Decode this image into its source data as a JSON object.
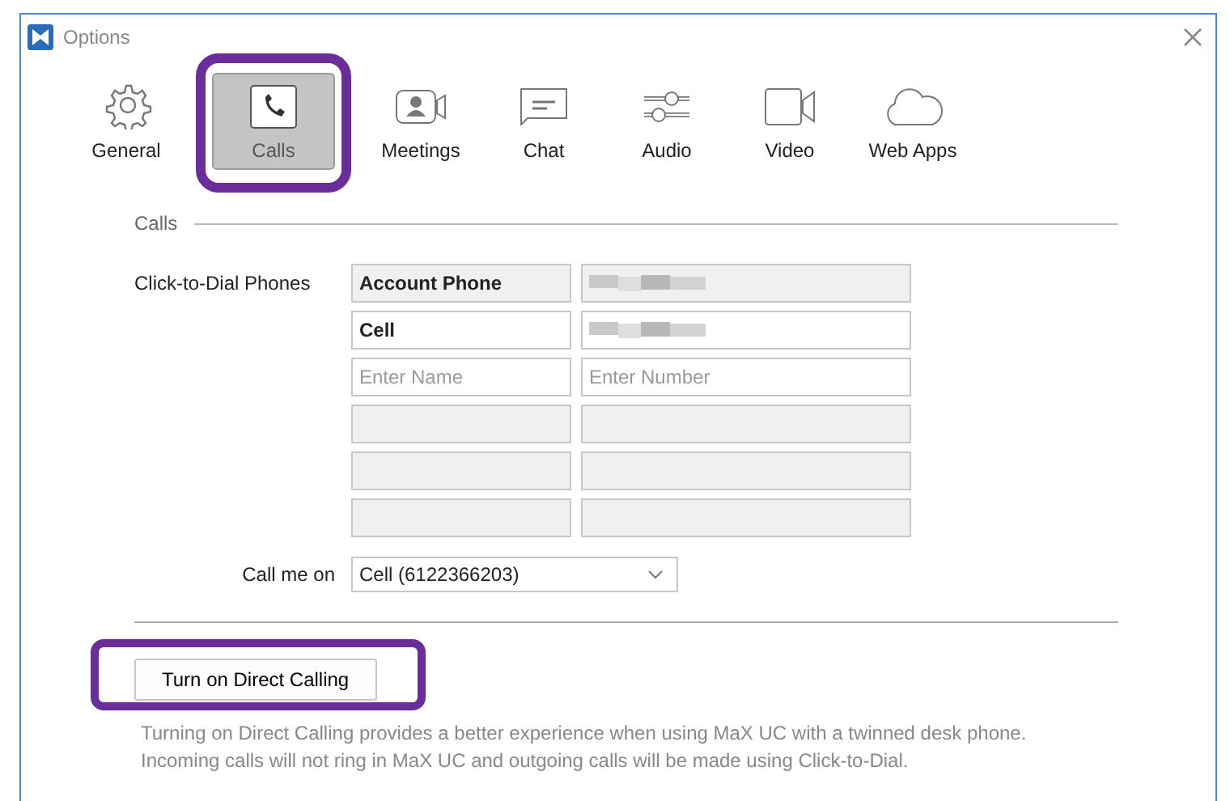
{
  "window": {
    "title": "Options"
  },
  "tabs": [
    {
      "label": "General",
      "selected": false
    },
    {
      "label": "Calls",
      "selected": true
    },
    {
      "label": "Meetings",
      "selected": false
    },
    {
      "label": "Chat",
      "selected": false
    },
    {
      "label": "Audio",
      "selected": false
    },
    {
      "label": "Video",
      "selected": false
    },
    {
      "label": "Web Apps",
      "selected": false
    }
  ],
  "calls": {
    "section_title": "Calls",
    "phones_label": "Click-to-Dial Phones",
    "phones": [
      {
        "name": "Account Phone",
        "disabled": true,
        "number_redacted": true
      },
      {
        "name": "Cell",
        "disabled": false,
        "number_redacted": true
      },
      {
        "name_placeholder": "Enter Name",
        "number_placeholder": "Enter Number",
        "disabled": false,
        "number_redacted": false
      },
      {
        "disabled": true,
        "number_redacted": false
      },
      {
        "disabled": true,
        "number_redacted": false
      },
      {
        "disabled": true,
        "number_redacted": false
      }
    ],
    "call_me_on_label": "Call me on",
    "call_me_on_value": "Cell (6122366203)"
  },
  "direct_calling": {
    "button": "Turn on Direct Calling",
    "description": "Turning on Direct Calling provides a better experience when using MaX UC with a twinned desk phone. Incoming calls will not ring in MaX UC and outgoing calls will be made using Click-to-Dial."
  }
}
